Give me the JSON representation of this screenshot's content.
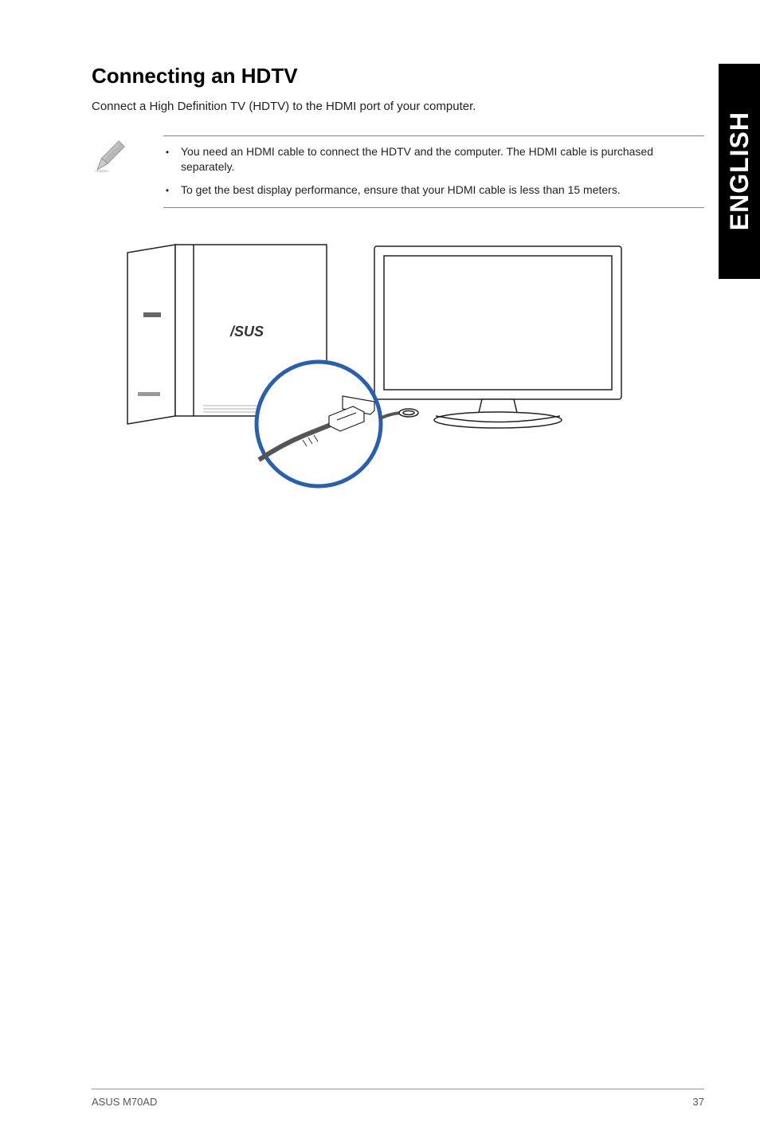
{
  "sideTab": "ENGLISH",
  "heading": "Connecting an HDTV",
  "intro": "Connect a High Definition TV (HDTV) to the HDMI port of your computer.",
  "notes": {
    "item1": "You need an HDMI cable to connect the HDTV and the computer. The HDMI cable is purchased separately.",
    "item2": "To get the best display performance, ensure that your HDMI cable is less than 15 meters."
  },
  "footer": {
    "left": "ASUS M70AD",
    "right": "37"
  }
}
